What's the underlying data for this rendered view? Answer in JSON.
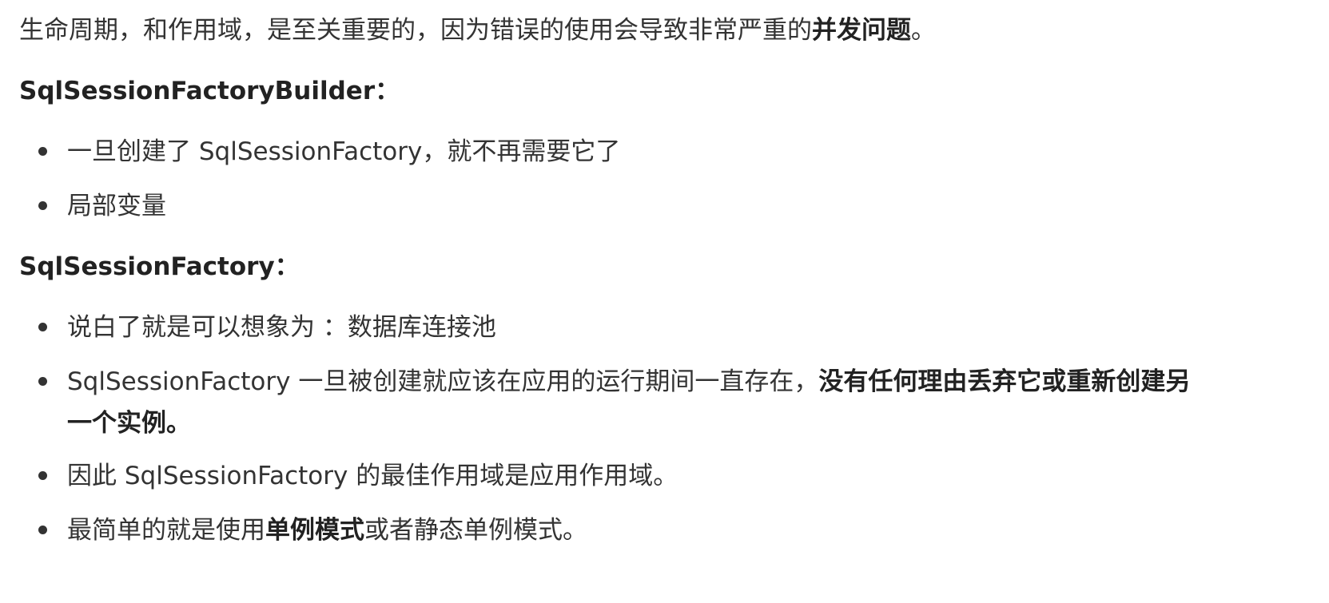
{
  "intro": {
    "text": "生命周期，和作用域，是至关重要的，因为错误的使用会导致非常严重的",
    "bold": "并发问题",
    "end": "。"
  },
  "sections": [
    {
      "heading": "SqlSessionFactoryBuilder：",
      "items": [
        {
          "text": "一旦创建了 SqlSessionFactory，就不再需要它了"
        },
        {
          "text": "局部变量"
        }
      ]
    },
    {
      "heading": "SqlSessionFactory：",
      "items": [
        {
          "text": "说白了就是可以想象为 ：数据库连接池"
        },
        {
          "text": "SqlSessionFactory 一旦被创建就应该在应用的运行期间一直存在，",
          "bold": "没有任何理由丢弃它或重新创建另一个实例。"
        },
        {
          "text": "因此 SqlSessionFactory 的最佳作用域是应用作用域。"
        },
        {
          "pre": "最简单的就是使用",
          "bold": "单例模式",
          "post": "或者静态单例模式。"
        }
      ]
    }
  ]
}
